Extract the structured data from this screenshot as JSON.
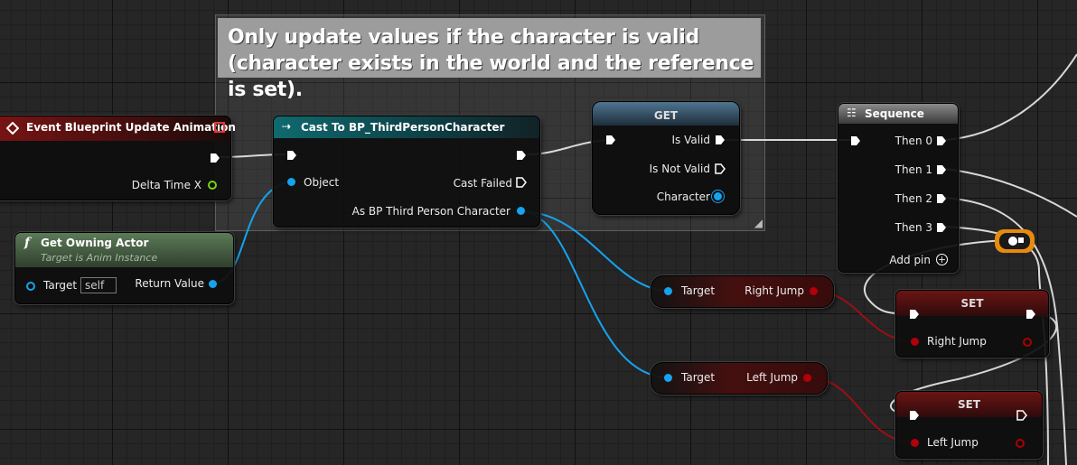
{
  "comment": {
    "text": "Only update values if the character is valid (character exists in the world and the reference is set)."
  },
  "event_node": {
    "title": "Event Blueprint Update Animation",
    "pin_delta": "Delta Time X",
    "color": "#7a1414"
  },
  "owning_actor_node": {
    "title": "Get Owning Actor",
    "subtitle": "Target is Anim Instance",
    "pin_target": "Target",
    "target_value": "self",
    "pin_return": "Return Value",
    "color": "#4a6a48"
  },
  "cast_node": {
    "title": "Cast To BP_ThirdPersonCharacter",
    "pin_object": "Object",
    "pin_cast_failed": "Cast Failed",
    "pin_as": "As BP Third Person Character",
    "color": "#0f5b5e"
  },
  "get_node": {
    "title": "GET",
    "pin_is_valid": "Is Valid",
    "pin_is_not_valid": "Is Not Valid",
    "pin_character": "Character",
    "color": "#3b5f7a"
  },
  "sequence_node": {
    "title": "Sequence",
    "outputs": [
      "Then 0",
      "Then 1",
      "Then 2",
      "Then 3"
    ],
    "add_pin": "Add pin"
  },
  "right_jump_get": {
    "target": "Target",
    "value": "Right Jump"
  },
  "left_jump_get": {
    "target": "Target",
    "value": "Left Jump"
  },
  "set_right": {
    "title": "SET",
    "pin": "Right Jump"
  },
  "set_left": {
    "title": "SET",
    "pin": "Left Jump"
  },
  "colors": {
    "exec": "#ffffff",
    "object_pin": "#15a3ee",
    "bool_pin": "#b2000a",
    "float_pin": "#72d414",
    "reroute": "#e78b0d"
  }
}
